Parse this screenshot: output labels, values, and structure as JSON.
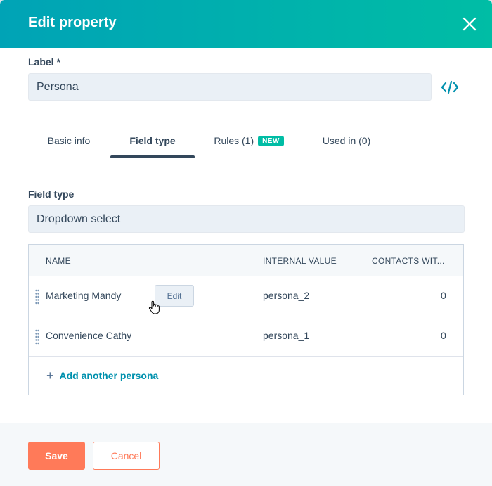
{
  "header": {
    "title": "Edit property",
    "close_icon": "close-icon"
  },
  "label_field": {
    "label": "Label *",
    "value": "Persona",
    "code_icon": "code-icon"
  },
  "tabs": [
    {
      "label": "Basic info",
      "active": false
    },
    {
      "label": "Field type",
      "active": true
    },
    {
      "label": "Rules (1)",
      "badge": "NEW",
      "active": false
    },
    {
      "label": "Used in (0)",
      "active": false
    }
  ],
  "field_type": {
    "label": "Field type",
    "value": "Dropdown select"
  },
  "table": {
    "columns": [
      "NAME",
      "INTERNAL VALUE",
      "CONTACTS WIT..."
    ],
    "rows": [
      {
        "name": "Marketing Mandy",
        "internal_value": "persona_2",
        "contacts": "0",
        "action": "Edit"
      },
      {
        "name": "Convenience Cathy",
        "internal_value": "persona_1",
        "contacts": "0"
      }
    ],
    "add_label": "Add another persona"
  },
  "footer": {
    "save_label": "Save",
    "cancel_label": "Cancel"
  },
  "colors": {
    "header_gradient_start": "#00a3b6",
    "header_gradient_end": "#00bda5",
    "primary_button": "#ff7a59",
    "link": "#0091ae",
    "text": "#33475b",
    "input_bg": "#eaf0f6",
    "badge": "#00bda5"
  }
}
